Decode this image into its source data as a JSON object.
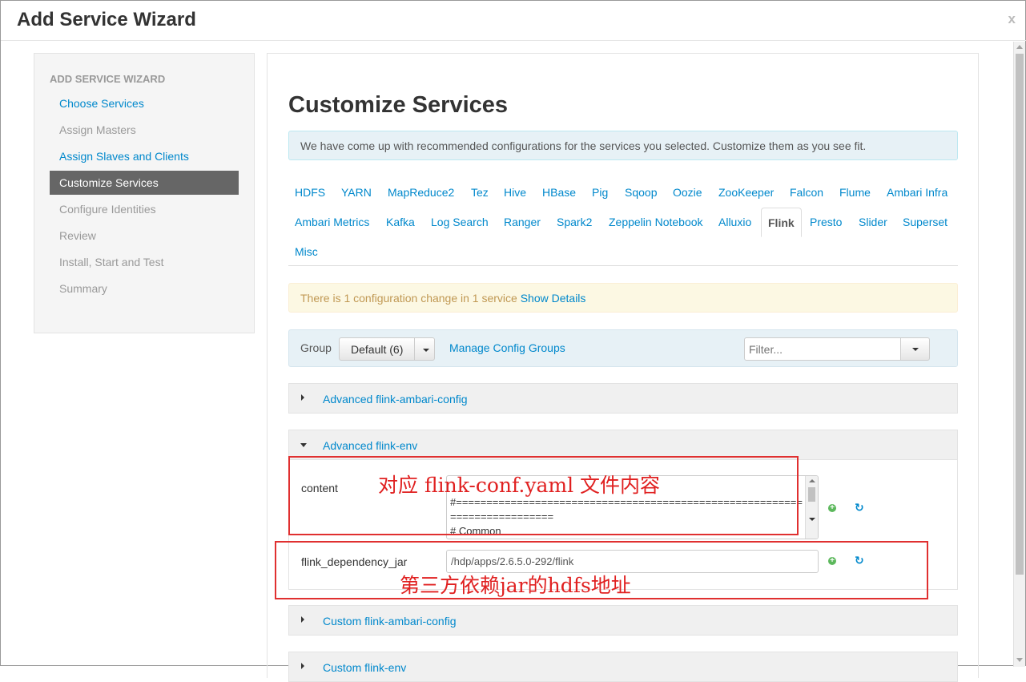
{
  "window": {
    "title": "Add Service Wizard",
    "close_label": "x"
  },
  "sidebar": {
    "header": "ADD SERVICE WIZARD",
    "items": [
      {
        "label": "Choose Services",
        "state": "link"
      },
      {
        "label": "Assign Masters",
        "state": "muted"
      },
      {
        "label": "Assign Slaves and Clients",
        "state": "link"
      },
      {
        "label": "Customize Services",
        "state": "active"
      },
      {
        "label": "Configure Identities",
        "state": "muted"
      },
      {
        "label": "Review",
        "state": "muted"
      },
      {
        "label": "Install, Start and Test",
        "state": "muted"
      },
      {
        "label": "Summary",
        "state": "muted"
      }
    ]
  },
  "main": {
    "title": "Customize Services",
    "info": "We have come up with recommended configurations for the services you selected. Customize them as you see fit.",
    "tabs": [
      "HDFS",
      "YARN",
      "MapReduce2",
      "Tez",
      "Hive",
      "HBase",
      "Pig",
      "Sqoop",
      "Oozie",
      "ZooKeeper",
      "Falcon",
      "Flume",
      "Ambari Infra",
      "Ambari Metrics",
      "Kafka",
      "Log Search",
      "Ranger",
      "Spark2",
      "Zeppelin Notebook",
      "Alluxio",
      "Flink",
      "Presto",
      "Slider",
      "Superset",
      "Misc"
    ],
    "active_tab": "Flink",
    "warning": {
      "text": "There is 1 configuration change in 1 service",
      "link": "Show Details"
    },
    "group": {
      "label": "Group",
      "value": "Default (6)",
      "manage_link": "Manage Config Groups",
      "filter_placeholder": "Filter..."
    },
    "sections": {
      "adv_ambari_config": "Advanced flink-ambari-config",
      "adv_env": "Advanced flink-env",
      "custom_ambari_config": "Custom flink-ambari-config",
      "custom_env": "Custom flink-env"
    },
    "fields": {
      "content": {
        "label": "content",
        "value": "#==========================================================================\n# Common"
      },
      "flink_dependency_jar": {
        "label": "flink_dependency_jar",
        "value": "/hdp/apps/2.6.5.0-292/flink"
      }
    }
  },
  "annotations": {
    "content_note": "对应 flink-conf.yaml 文件内容",
    "jar_note": "第三方依赖jar的hdfs地址",
    "color": "#e02020"
  },
  "colors": {
    "link": "#0088cc",
    "active_bg": "#666666",
    "info_bg": "#e7f1f6",
    "warn_bg": "#fcf8e3"
  }
}
